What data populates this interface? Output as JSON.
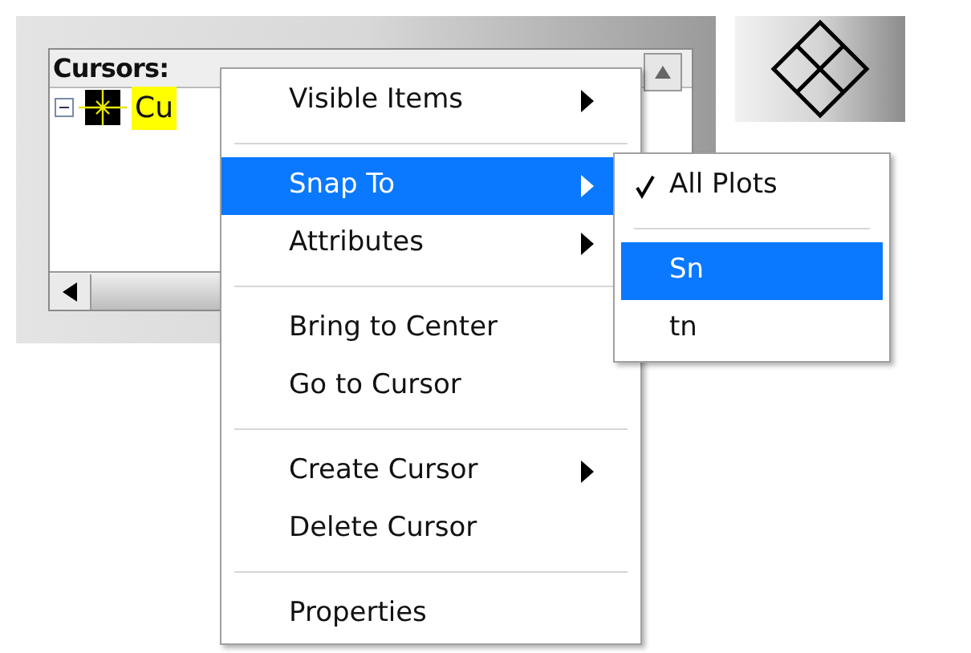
{
  "cursor_legend": {
    "header": "Cursors:",
    "rows": [
      {
        "label": "Cu",
        "expanded": true,
        "selected": true
      }
    ]
  },
  "context_menu": {
    "items": [
      {
        "kind": "item",
        "label": "Visible Items",
        "submenu": true,
        "selected": false
      },
      {
        "kind": "separator"
      },
      {
        "kind": "item",
        "label": "Snap To",
        "submenu": true,
        "selected": true
      },
      {
        "kind": "item",
        "label": "Attributes",
        "submenu": true,
        "selected": false
      },
      {
        "kind": "separator"
      },
      {
        "kind": "item",
        "label": "Bring to Center",
        "submenu": false,
        "selected": false
      },
      {
        "kind": "item",
        "label": "Go to Cursor",
        "submenu": false,
        "selected": false
      },
      {
        "kind": "separator"
      },
      {
        "kind": "item",
        "label": "Create Cursor",
        "submenu": true,
        "selected": false
      },
      {
        "kind": "item",
        "label": "Delete Cursor",
        "submenu": false,
        "selected": false
      },
      {
        "kind": "separator"
      },
      {
        "kind": "item",
        "label": "Properties",
        "submenu": false,
        "selected": false
      }
    ]
  },
  "submenu": {
    "items": [
      {
        "kind": "item",
        "label": "All Plots",
        "checked": true,
        "selected": false
      },
      {
        "kind": "separator"
      },
      {
        "kind": "item",
        "label": "Sn",
        "checked": false,
        "selected": true
      },
      {
        "kind": "item",
        "label": "tn",
        "checked": false,
        "selected": false
      }
    ]
  }
}
